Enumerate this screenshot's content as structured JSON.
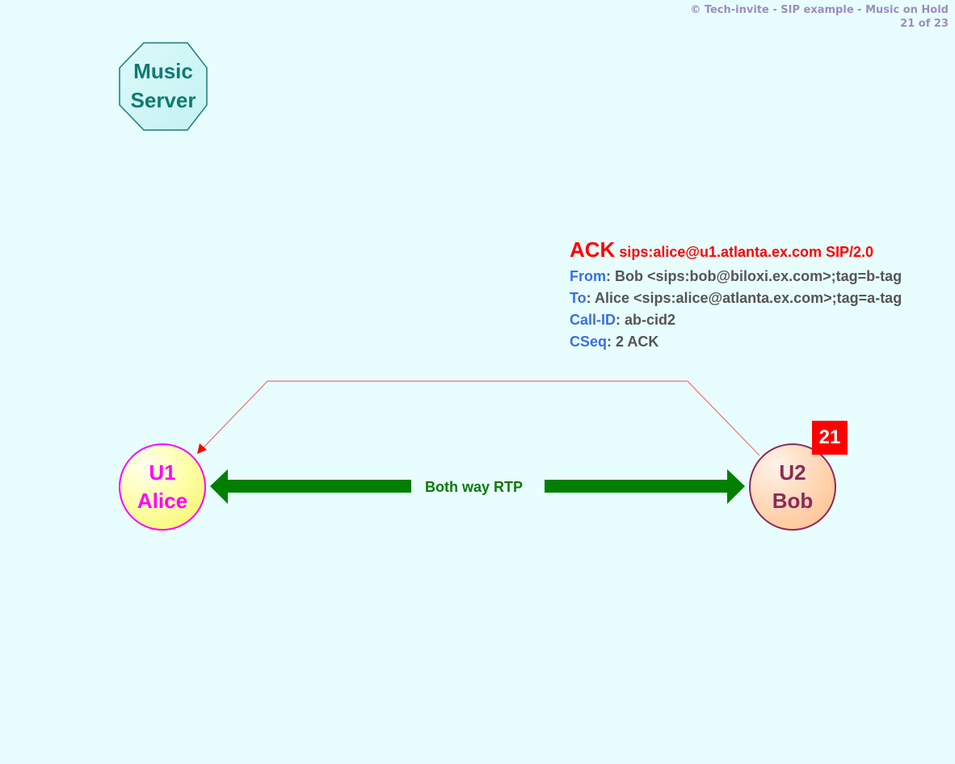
{
  "header": {
    "title": "© Tech-invite - SIP example - Music on Hold",
    "page": "21 of 23"
  },
  "nodes": {
    "music_server": {
      "line1": "Music",
      "line2": "Server",
      "shape": "octagon"
    },
    "alice": {
      "line1": "U1",
      "line2": "Alice"
    },
    "bob": {
      "line1": "U2",
      "line2": "Bob"
    }
  },
  "message": {
    "method": "ACK",
    "request_uri": "sips:alice@u1.atlanta.ex.com SIP/2.0",
    "headers": [
      {
        "name": "From",
        "sep": ": ",
        "value": "Bob <sips:bob@biloxi.ex.com>;tag=b-tag"
      },
      {
        "name": "To",
        "sep": ": ",
        "value": "Alice <sips:alice@atlanta.ex.com>;tag=a-tag"
      },
      {
        "name": "Call-ID",
        "sep": ": ",
        "value": "ab-cid2"
      },
      {
        "name": "CSeq",
        "sep": ": ",
        "value": "2 ACK"
      }
    ],
    "from": "U2 Bob",
    "to": "U1 Alice"
  },
  "media": {
    "label": "Both way RTP",
    "direction": "bidirectional"
  },
  "step_badge": "21",
  "colors": {
    "background": "#e8fefe",
    "signal_line": "#f07070",
    "arrowhead": "#ff0000",
    "rtp": "#007f00",
    "alice_stroke": "#ff00ff",
    "bob_stroke": "#8b2a5a",
    "server_stroke": "#1a7a7a",
    "header_name": "#3a6ee8",
    "header_value": "#555555",
    "method": "#ff0000"
  }
}
